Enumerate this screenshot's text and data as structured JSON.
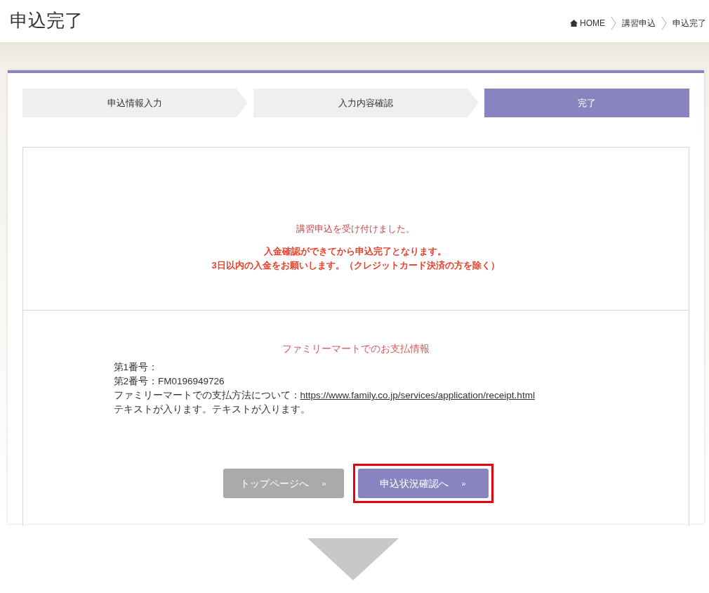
{
  "page_title": "申込完了",
  "breadcrumb": [
    {
      "label": "HOME",
      "kind": "home"
    },
    {
      "label": "講習申込",
      "kind": "link"
    },
    {
      "label": "申込完了",
      "kind": "current"
    }
  ],
  "steps": [
    {
      "label": "申込情報入力",
      "selected": false
    },
    {
      "label": "入力内容確認",
      "selected": false
    },
    {
      "label": "完了",
      "selected": true
    }
  ],
  "message": {
    "received": "講習申込を受け付けました。",
    "notice_lines": [
      "入金確認ができてから申込完了となります。",
      "3日以内の入金をお願いします。（クレジットカード決済の方を除く）"
    ]
  },
  "payment": {
    "heading": "ファミリーマートでのお支払情報",
    "lines": [
      {
        "label": "第1番号："
      },
      {
        "label": "第2番号：",
        "value": "FM0196949726"
      },
      {
        "label": "ファミリーマートでの支払方法について：",
        "link": "https://www.family.co.jp/services/application/receipt.html"
      },
      {
        "label": "テキストが入ります。テキストが入ります。"
      }
    ]
  },
  "buttons": [
    {
      "label": "トップページへ",
      "arrow": "»",
      "kind": "secondary",
      "highlighted": false
    },
    {
      "label": "申込状況確認へ",
      "arrow": "»",
      "kind": "primary",
      "highlighted": true
    }
  ]
}
